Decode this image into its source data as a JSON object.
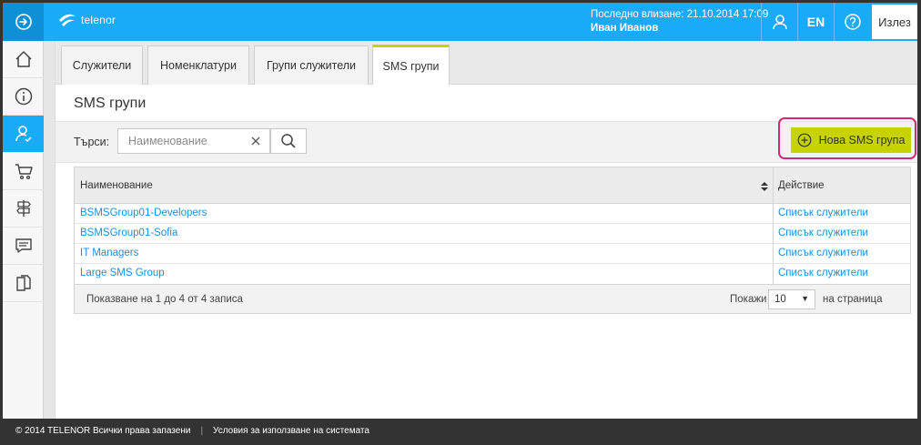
{
  "header": {
    "logo_text": "telenor",
    "last_login": "Последно влизане: 21.10.2014 17:09",
    "user_name": "Иван Иванов",
    "lang": "EN",
    "logout": "Излез"
  },
  "tabs": [
    "Служители",
    "Номенклатури",
    "Групи служители",
    "SMS групи"
  ],
  "page": {
    "title": "SMS групи",
    "search_label": "Търси:",
    "search_placeholder": "Наименование",
    "new_button": "Нова SMS група"
  },
  "table": {
    "headers": [
      "Наименование",
      "Действие"
    ],
    "rows": [
      {
        "name": "BSMSGroup01-Developers",
        "action": "Списък служители"
      },
      {
        "name": "BSMSGroup01-Sofia",
        "action": "Списък служители"
      },
      {
        "name": "IT Managers",
        "action": "Списък служители"
      },
      {
        "name": "Large SMS Group",
        "action": "Списък служители"
      }
    ],
    "info": "Показване на 1 до 4 от 4 записа",
    "show_label": "Покажи",
    "page_size": "10",
    "per_page": "на страница"
  },
  "footer": {
    "copyright": "© 2014 TELENOR Всички права запазени",
    "separator": "|",
    "terms": "Условия за използване на системата"
  },
  "colors": {
    "header_blue": "#19aaf8",
    "accent_green": "#c6d300",
    "highlight_ring": "#d1297a",
    "link": "#1a8fd9"
  },
  "sidebar_icons": [
    "home-icon",
    "info-icon",
    "user-check-icon",
    "cart-icon",
    "signpost-icon",
    "chat-icon",
    "documents-icon"
  ]
}
